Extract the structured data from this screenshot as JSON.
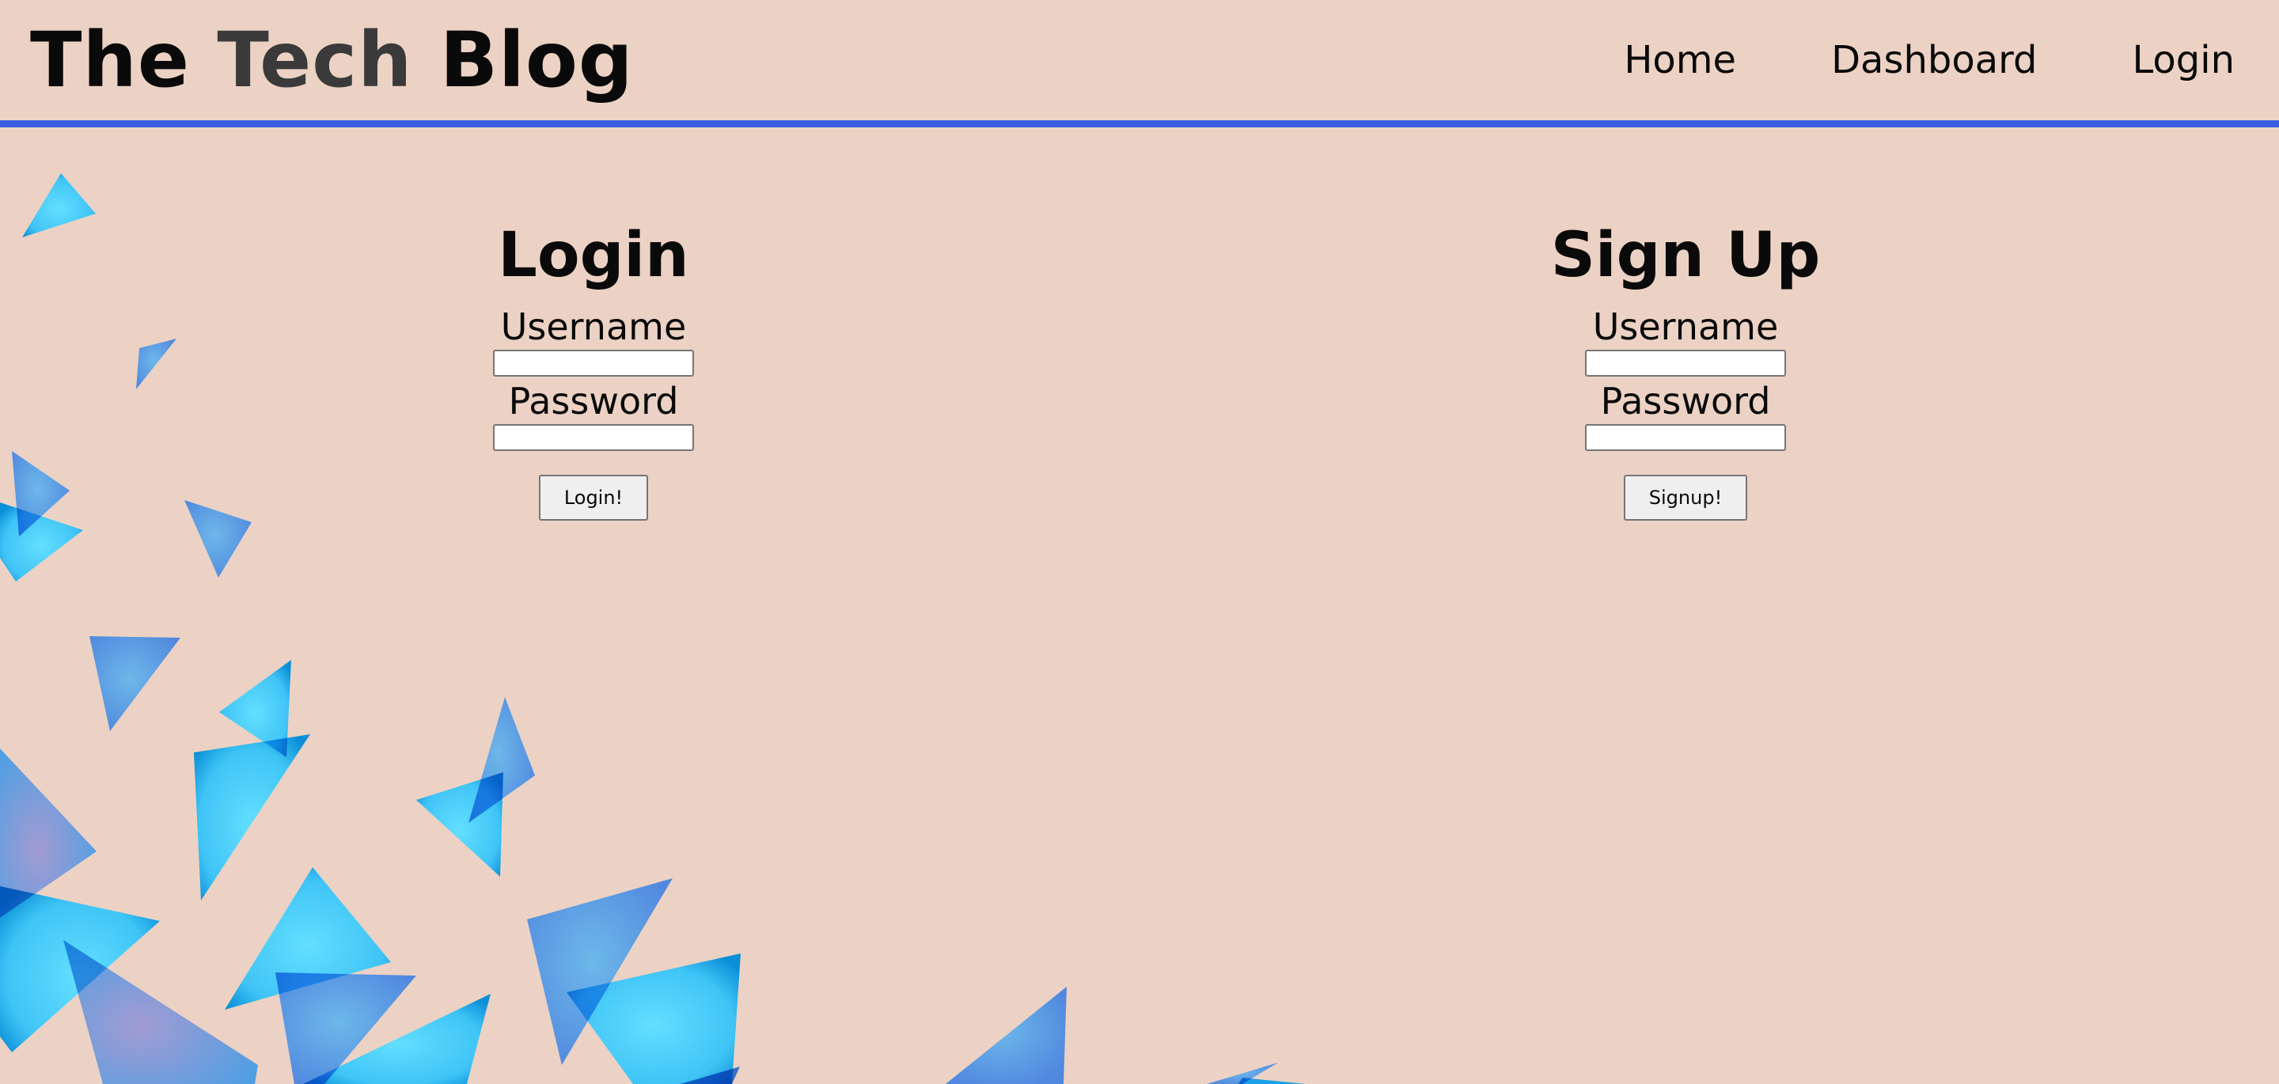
{
  "header": {
    "brand_prefix": "The ",
    "brand_accent": "Tech",
    "brand_suffix": " Blog",
    "nav": [
      "Home",
      "Dashboard",
      "Login"
    ]
  },
  "login": {
    "title": "Login",
    "username_label": "Username",
    "username_value": "",
    "password_label": "Password",
    "password_value": "",
    "submit_label": "Login!"
  },
  "signup": {
    "title": "Sign Up",
    "username_label": "Username",
    "username_value": "",
    "password_label": "Password",
    "password_value": "",
    "submit_label": "Signup!"
  },
  "theme": {
    "background": "#ecd2c4",
    "header_rule": "#3b5fe0",
    "triangle_light": "#54d6ff",
    "triangle_mid": "#1aa0e6",
    "triangle_violet": "#9b93cf"
  }
}
